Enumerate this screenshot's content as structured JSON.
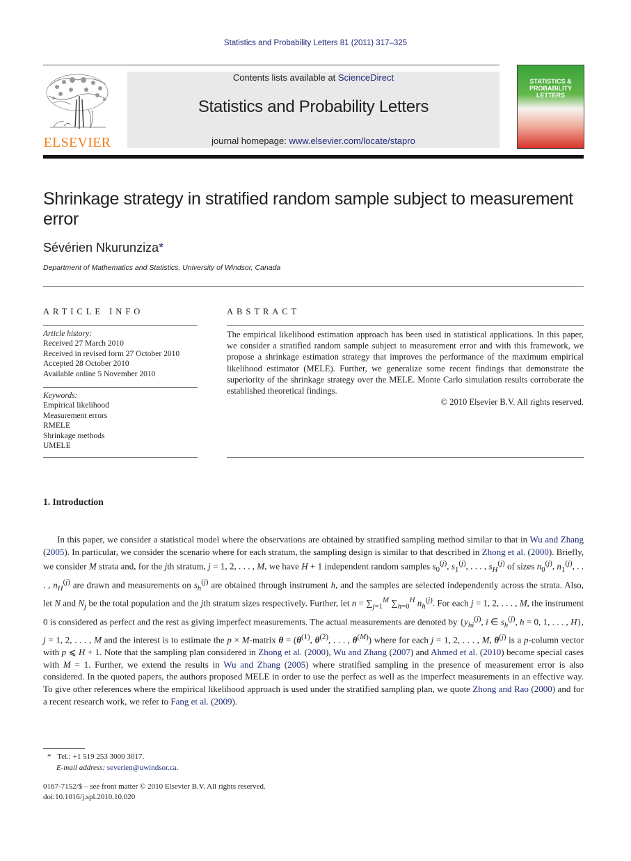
{
  "header": {
    "citation": "Statistics and Probability Letters 81 (2011) 317–325",
    "contents_prefix": "Contents lists available at ",
    "contents_link": "ScienceDirect",
    "journal_name": "Statistics and Probability Letters",
    "homepage_prefix": "journal homepage: ",
    "homepage_link": "www.elsevier.com/locate/stapro",
    "publisher_logo_text": "ELSEVIER",
    "cover_title": [
      "STATISTICS &",
      "PROBABILITY",
      "LETTERS"
    ]
  },
  "article": {
    "title": "Shrinkage strategy in stratified random sample subject to measurement error",
    "author": "Sévérien Nkurunziza",
    "author_marker": "*",
    "affiliation": "Department of Mathematics and Statistics, University of Windsor, Canada"
  },
  "article_info": {
    "label": "ARTICLE INFO",
    "history_label": "Article history:",
    "history": [
      "Received 27 March 2010",
      "Received in revised form 27 October 2010",
      "Accepted 28 October 2010",
      "Available online 5 November 2010"
    ],
    "keywords_label": "Keywords:",
    "keywords": [
      "Empirical likelihood",
      "Measurement errors",
      "RMELE",
      "Shrinkage methods",
      "UMELE"
    ]
  },
  "abstract": {
    "label": "ABSTRACT",
    "text": "The empirical likelihood estimation approach has been used in statistical applications. In this paper, we consider a stratified random sample subject to measurement error and with this framework, we propose a shrinkage estimation strategy that improves the performance of the maximum empirical likelihood estimator (MELE). Further, we generalize some recent findings that demonstrate the superiority of the shrinkage strategy over the MELE. Monte Carlo simulation results corroborate the established theoretical findings.",
    "copyright": "© 2010 Elsevier B.V. All rights reserved."
  },
  "introduction": {
    "heading": "1.  Introduction",
    "refs": {
      "wu_zhang_2005": "Wu and Zhang",
      "y2005": "2005",
      "zhong_2000": "Zhong et al.",
      "y2000": "2000",
      "wu_zhang_2007": "Wu and Zhang",
      "y2007": "2007",
      "ahmed_2010": "Ahmed et al.",
      "y2010": "2010",
      "zhong_rao_2000": "Zhong and Rao",
      "fang_2009": "Fang et al.",
      "y2009": "2009"
    }
  },
  "footer": {
    "footnote_marker": "*",
    "tel": "Tel.: +1 519 253 3000 3017.",
    "email_label": "E-mail address: ",
    "email": "severien@uwindsor.ca",
    "front_matter": "0167-7152/$ – see front matter © 2010 Elsevier B.V. All rights reserved.",
    "doi": "doi:10.1016/j.spl.2010.10.020"
  }
}
